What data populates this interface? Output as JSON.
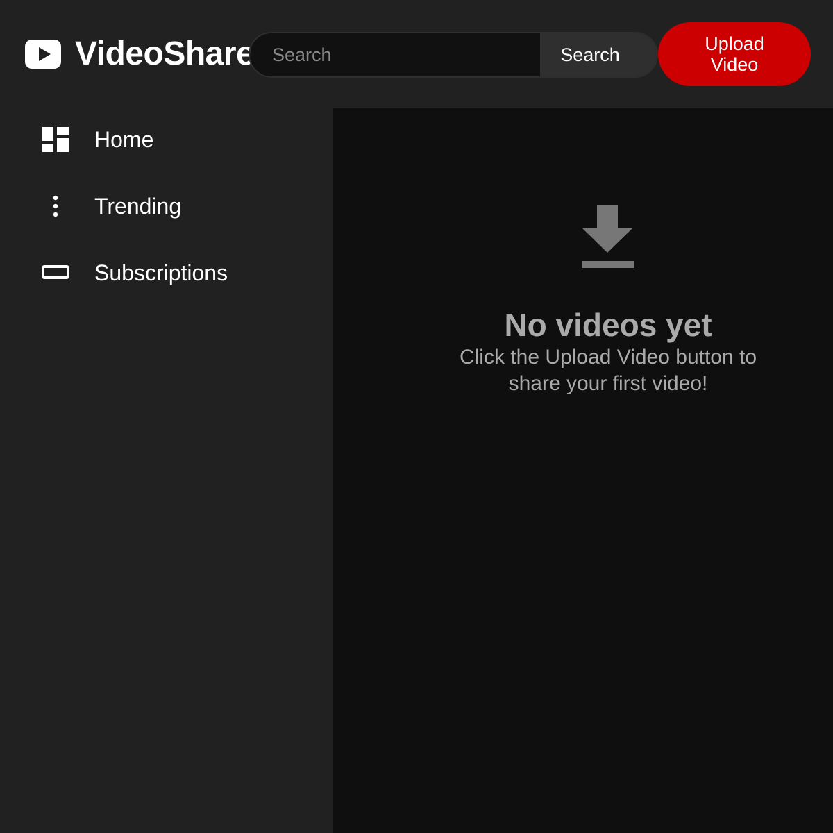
{
  "header": {
    "app_name": "VideoShare",
    "logo_icon": "play-logo-icon",
    "search": {
      "placeholder": "Search",
      "value": "",
      "button_label": "Search"
    },
    "upload_button_label": "Upload Video"
  },
  "sidebar": {
    "items": [
      {
        "label": "Home",
        "icon": "dashboard-icon"
      },
      {
        "label": "Trending",
        "icon": "more-vertical-icon"
      },
      {
        "label": "Subscriptions",
        "icon": "rectangle-icon"
      }
    ]
  },
  "main": {
    "empty_state": {
      "icon": "download-icon",
      "title": "No videos yet",
      "description": "Click the Upload Video button to share your first video!"
    }
  },
  "colors": {
    "accent": "#cc0000",
    "background": "#212121",
    "content_background": "#0f0f0f",
    "muted_text": "#aaaaaa"
  }
}
